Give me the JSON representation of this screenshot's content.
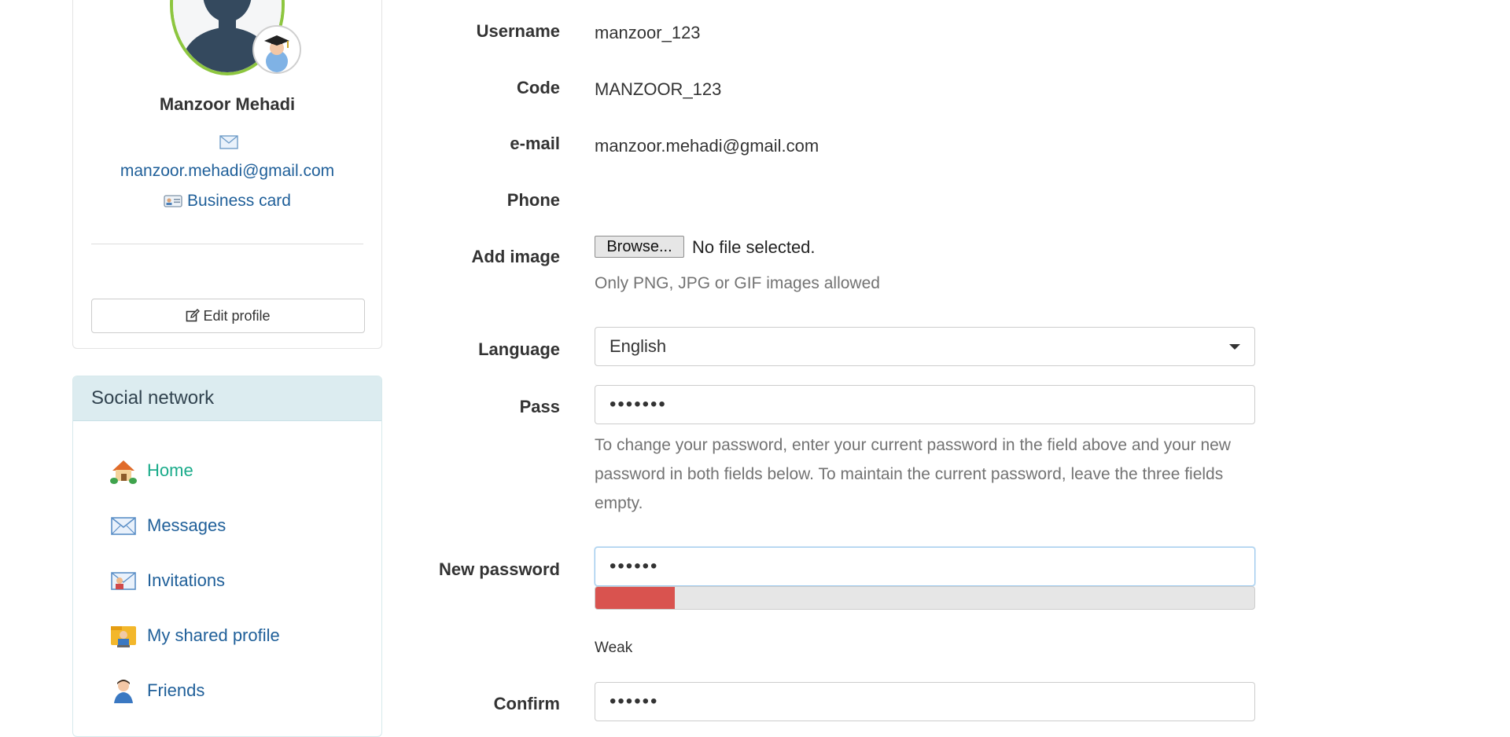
{
  "profile": {
    "name": "Manzoor Mehadi",
    "email": "manzoor.mehadi@gmail.com",
    "business_card": "Business card",
    "edit_profile": "Edit profile"
  },
  "social": {
    "title": "Social network",
    "items": [
      {
        "label": "Home",
        "icon": "home-icon",
        "active": true
      },
      {
        "label": "Messages",
        "icon": "envelope-icon",
        "active": false
      },
      {
        "label": "Invitations",
        "icon": "invitation-icon",
        "active": false
      },
      {
        "label": "My shared profile",
        "icon": "shared-profile-icon",
        "active": false
      },
      {
        "label": "Friends",
        "icon": "friends-icon",
        "active": false
      }
    ]
  },
  "form": {
    "username_label": "Username",
    "username_value": "manzoor_123",
    "code_label": "Code",
    "code_value": "MANZOOR_123",
    "email_label": "e-mail",
    "email_value": "manzoor.mehadi@gmail.com",
    "phone_label": "Phone",
    "add_image_label": "Add image",
    "browse_label": "Browse...",
    "no_file": "No file selected.",
    "image_help": "Only PNG, JPG or GIF images allowed",
    "language_label": "Language",
    "language_value": "English",
    "pass_label": "Pass",
    "pass_value": "•••••••",
    "pass_help": "To change your password, enter your current password in the field above and your new password in both fields below. To maintain the current password, leave the three fields empty.",
    "new_password_label": "New password",
    "new_password_value": "••••••",
    "strength_percent": 12,
    "strength_text": "Weak",
    "confirm_label": "Confirm",
    "confirm_value": "••••••"
  },
  "colors": {
    "link": "#1f5f99",
    "active_link": "#1aab8a",
    "avatar_ring": "#8dc63f",
    "strength_weak": "#d9534f",
    "panel_header": "#dcecf0"
  }
}
